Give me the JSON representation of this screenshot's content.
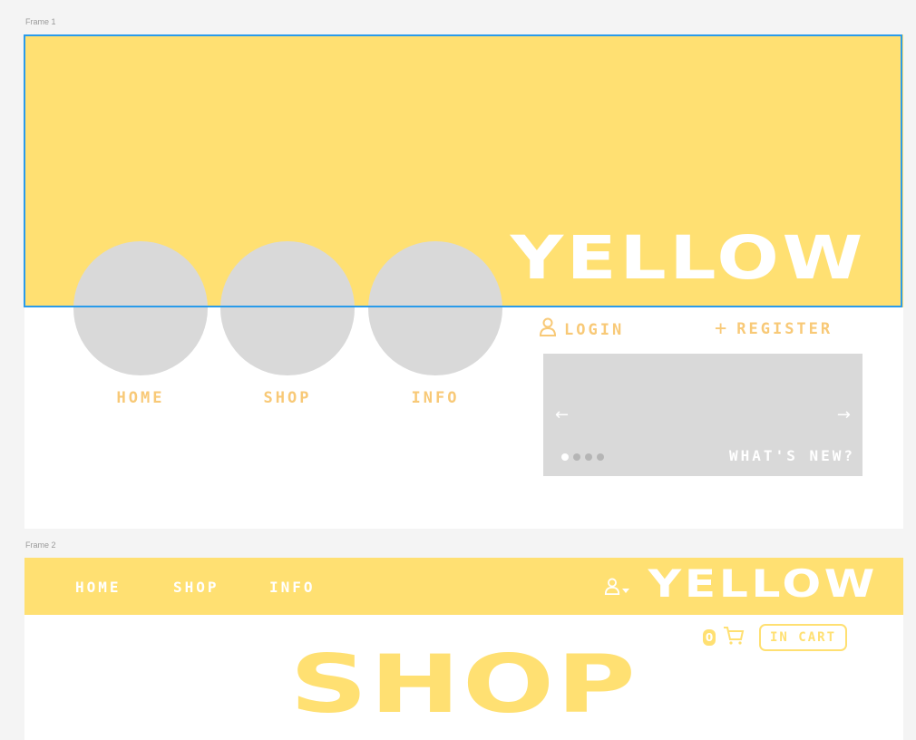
{
  "frame1": {
    "label": "Frame 1",
    "logo": "YELLOW",
    "nav": [
      {
        "label": "HOME"
      },
      {
        "label": "SHOP"
      },
      {
        "label": "INFO"
      }
    ],
    "auth": {
      "login": "LOGIN",
      "register": "REGISTER"
    },
    "carousel": {
      "caption": "WHAT'S NEW?",
      "prev_icon": "arrow-left-icon",
      "next_icon": "arrow-right-icon",
      "slide_count": 4,
      "active_slide": 1
    }
  },
  "frame2": {
    "label": "Frame 2",
    "nav": [
      {
        "label": "HOME"
      },
      {
        "label": "SHOP"
      },
      {
        "label": "INFO"
      }
    ],
    "logo": "YELLOW",
    "cart": {
      "count": "0",
      "status": "IN CART"
    },
    "page_title": "SHOP"
  },
  "colors": {
    "brand_yellow": "#ffe072",
    "text_orange": "#f8c977",
    "placeholder_gray": "#d9d9d9",
    "selection_blue": "#2a9bea"
  }
}
